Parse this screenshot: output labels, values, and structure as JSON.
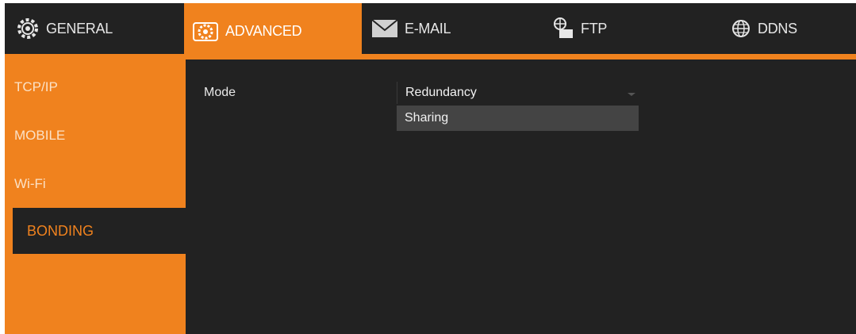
{
  "tabs": [
    {
      "label": "GENERAL",
      "icon": "gear-icon",
      "active": false
    },
    {
      "label": "ADVANCED",
      "icon": "advanced-gear-icon",
      "active": true
    },
    {
      "label": "E-MAIL",
      "icon": "envelope-icon",
      "active": false
    },
    {
      "label": "FTP",
      "icon": "ftp-globe-icon",
      "active": false
    },
    {
      "label": "DDNS",
      "icon": "globe-icon",
      "active": false
    }
  ],
  "sidebar": {
    "items": [
      {
        "label": "TCP/IP",
        "active": false
      },
      {
        "label": "MOBILE",
        "active": false
      },
      {
        "label": "Wi-Fi",
        "active": false
      },
      {
        "label": "BONDING",
        "active": true
      }
    ]
  },
  "main": {
    "mode_label": "Mode",
    "mode_value": "Redundancy",
    "options": [
      "Sharing"
    ]
  },
  "colors": {
    "accent": "#f0821e",
    "background": "#222222",
    "highlight": "#444444"
  }
}
